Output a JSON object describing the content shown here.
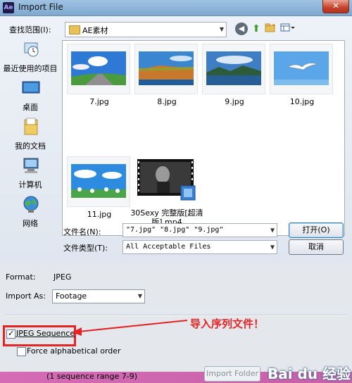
{
  "window": {
    "app_icon": "Ae",
    "title": "Import File",
    "close_label": "✕"
  },
  "lookin": {
    "label": "查找范围(I):",
    "value": "AE素材"
  },
  "places": [
    {
      "label": "最近使用的项目",
      "icon": "recent-icon"
    },
    {
      "label": "桌面",
      "icon": "desktop-icon"
    },
    {
      "label": "我的文档",
      "icon": "documents-icon"
    },
    {
      "label": "计算机",
      "icon": "computer-icon"
    },
    {
      "label": "网络",
      "icon": "network-icon"
    }
  ],
  "files": [
    {
      "name": "7.jpg"
    },
    {
      "name": "8.jpg"
    },
    {
      "name": "9.jpg"
    },
    {
      "name": "10.jpg"
    },
    {
      "name": "11.jpg"
    },
    {
      "name": "30Sexy 完整版[超清版].mp4"
    }
  ],
  "filename": {
    "label": "文件名(N):",
    "value": "\"7.jpg\" \"8.jpg\" \"9.jpg\""
  },
  "filetype": {
    "label": "文件类型(T):",
    "value": "All Acceptable Files"
  },
  "buttons": {
    "open": "打开(O)",
    "cancel": "取消",
    "import_folder": "Import Folder"
  },
  "format": {
    "label": "Format:",
    "value": "JPEG"
  },
  "import_as": {
    "label": "Import As:",
    "value": "Footage"
  },
  "jpeg_sequence": {
    "label": "JPEG Sequence",
    "checked": true
  },
  "force_alpha": {
    "label": "Force alphabetical order",
    "checked": false
  },
  "sequence_info": "(1 sequence range 7-9)",
  "annotation": "导入序列文件！",
  "watermark": "Bai du 经验",
  "colors": {
    "annotation_red": "#e42323",
    "titlebar_blue": "#8fb4da"
  }
}
